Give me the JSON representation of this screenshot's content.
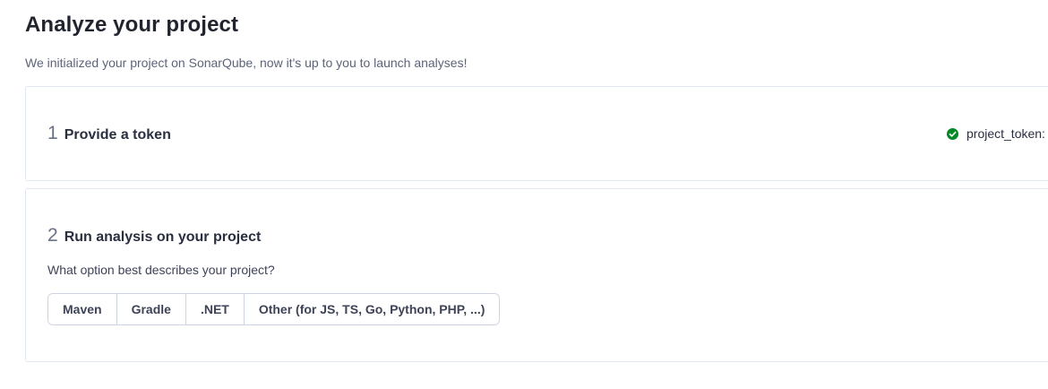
{
  "page": {
    "title": "Analyze your project",
    "subtitle": "We initialized your project on SonarQube, now it's up to you to launch analyses!"
  },
  "step1": {
    "number": "1",
    "title": "Provide a token",
    "token_label": "project_token:",
    "status_icon": "check-circle-icon",
    "status_color": "#008a25"
  },
  "step2": {
    "number": "2",
    "title": "Run analysis on your project",
    "question": "What option best describes your project?",
    "options": [
      {
        "label": "Maven"
      },
      {
        "label": "Gradle"
      },
      {
        "label": ".NET"
      },
      {
        "label": "Other (for JS, TS, Go, Python, PHP, ...)"
      }
    ]
  }
}
